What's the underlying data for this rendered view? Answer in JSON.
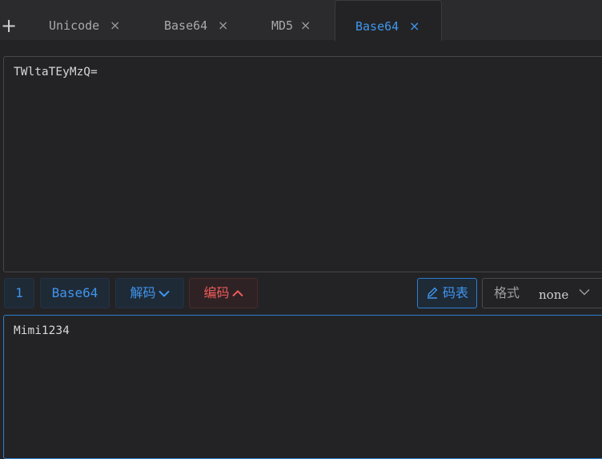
{
  "tabs": {
    "add_icon": "plus-icon",
    "items": [
      {
        "label": "Unicode",
        "close": "×",
        "active": false
      },
      {
        "label": "Base64",
        "close": "×",
        "active": false
      },
      {
        "label": "MD5",
        "close": "×",
        "active": false
      },
      {
        "label": "Base64",
        "close": "×",
        "active": true
      }
    ]
  },
  "input": {
    "value": "TWltaTEyMzQ="
  },
  "toolbar": {
    "index": "1",
    "algorithm": "Base64",
    "decode_label": "解码",
    "decode_icon": "chevron-down-icon",
    "encode_label": "编码",
    "encode_icon": "chevron-up-icon",
    "code_table_label": "码表",
    "code_table_icon": "pen-icon",
    "format_label": "格式",
    "format_value": "none",
    "format_icon": "chevron-down-icon"
  },
  "output": {
    "value": "Mimi1234"
  },
  "colors": {
    "accent": "#3f96ee",
    "danger": "#ef5b5b",
    "background": "#232325",
    "tabbar": "#2b2b2e"
  }
}
